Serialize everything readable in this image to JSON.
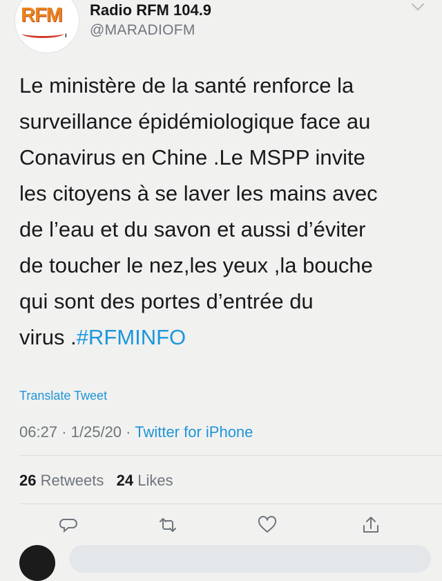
{
  "account": {
    "name": "Radio RFM 104.9",
    "handle": "@MARADIOFM",
    "avatar_logo": "RFM"
  },
  "tweet": {
    "text_lines": [
      "Le ministère de la santé renforce la",
      "surveillance épidémiologique face au",
      "Conavirus en Chine .Le MSPP invite",
      "les citoyens à se laver les mains avec",
      "de l’eau et du savon et aussi d’éviter",
      "de toucher le nez,les yeux ,la bouche",
      "qui sont des portes d’entrée du",
      "virus ."
    ],
    "hashtag": "#RFMINFO",
    "translate_label": "Translate Tweet",
    "time": "06:27",
    "date": "1/25/20",
    "separator": "·",
    "source": "Twitter for iPhone"
  },
  "stats": {
    "retweets_count": "26",
    "retweets_label": "Retweets",
    "likes_count": "24",
    "likes_label": "Likes"
  },
  "icons": {
    "menu": "chevron-down-icon",
    "reply": "reply-icon",
    "retweet": "retweet-icon",
    "like": "heart-icon",
    "share": "share-icon"
  },
  "colors": {
    "link": "#1d95d6",
    "hashtag": "#1b97dc",
    "muted": "#6e757b",
    "logo_orange": "#e8861a",
    "logo_red": "#d23a2a"
  }
}
